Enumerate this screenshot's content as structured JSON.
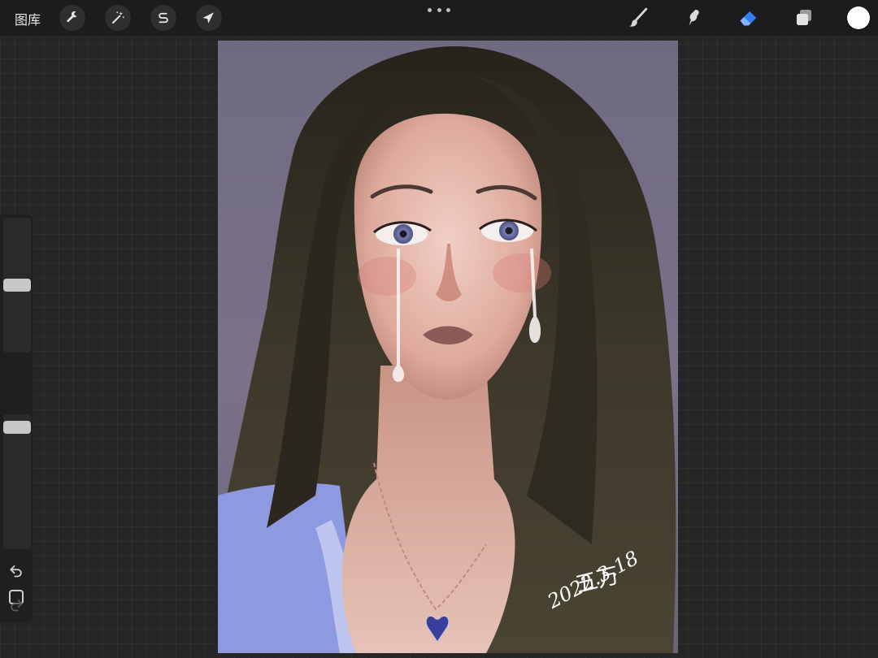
{
  "topbar": {
    "gallery_label": "图库",
    "left_tools": [
      {
        "name": "actions",
        "icon": "wrench-icon"
      },
      {
        "name": "adjustments",
        "icon": "magic-wand-icon"
      },
      {
        "name": "selection",
        "icon": "selection-s-icon"
      },
      {
        "name": "transform",
        "icon": "arrow-cursor-icon"
      }
    ],
    "right_tools": [
      {
        "name": "brush",
        "icon": "brush-icon",
        "active": false
      },
      {
        "name": "smudge",
        "icon": "smudge-icon",
        "active": false
      },
      {
        "name": "eraser",
        "icon": "eraser-icon",
        "active": true
      },
      {
        "name": "layers",
        "icon": "layers-icon",
        "active": false
      }
    ],
    "current_color": "#ffffff"
  },
  "sidebar": {
    "brush_size_level": 0.5,
    "opacity_level": 0.05,
    "modify_icon": "square-icon",
    "undo_icon": "undo-icon",
    "redo_icon": "redo-icon"
  },
  "artwork": {
    "signature_name": "五万",
    "signature_date": "2022.3.18"
  },
  "colors": {
    "accent_active": "#2f7ff0",
    "toolbar_bg": "#1c1c1e",
    "workspace_bg": "#252526"
  }
}
